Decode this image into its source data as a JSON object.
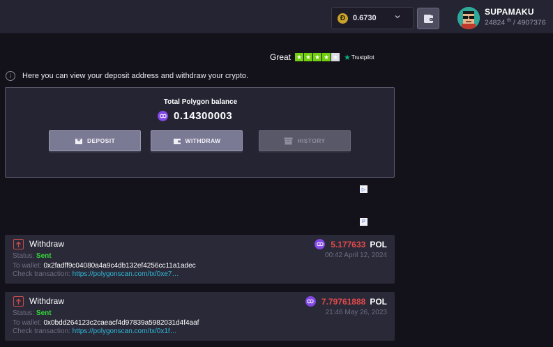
{
  "header": {
    "balance_coin_icon": "dogecoin-icon",
    "balance_value": "0.6730",
    "username": "SUPAMAKU",
    "rank_position": "24824",
    "rank_suffix": "th",
    "rank_total": "/ 4907376"
  },
  "trustpilot": {
    "label": "Great",
    "stars_filled": 4,
    "stars_total": 5,
    "brand": "Trustpilot"
  },
  "info_text": "Here you can view your deposit address and withdraw your crypto.",
  "balance_panel": {
    "title": "Total Polygon balance",
    "amount": "0.14300003",
    "buttons": {
      "deposit": "Deposit",
      "withdraw": "Withdraw",
      "history": "History"
    }
  },
  "transactions": [
    {
      "type": "Withdraw",
      "status_label": "Status:",
      "status": "Sent",
      "wallet_label": "To wallet:",
      "wallet": "0x2fadff9c04080a4a9c4db132ef4256cc11a1adec",
      "check_label": "Check transaction:",
      "check_link": "https://polygonscan.com/tx/0xe7…",
      "amount": "5.177633",
      "currency": "POL",
      "date": "00:42 April 12, 2024"
    },
    {
      "type": "Withdraw",
      "status_label": "Status:",
      "status": "Sent",
      "wallet_label": "To wallet:",
      "wallet": "0x0bdd264123c2caeac f4d97839a5982031d4f4aaf",
      "check_label": "Check transaction:",
      "check_link": "https://polygonscan.com/tx/0x1f…",
      "amount": "7.79761888",
      "currency": "POL",
      "date": "21:46 May 26, 2023"
    }
  ],
  "colors": {
    "accent_polygon": "#8247e5",
    "status_sent": "#36d63a",
    "amount_negative": "#e24a4a",
    "link": "#2fb8d6"
  }
}
